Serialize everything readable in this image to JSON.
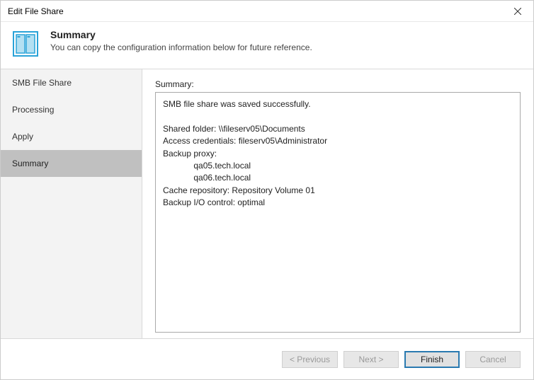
{
  "window": {
    "title": "Edit File Share"
  },
  "header": {
    "title": "Summary",
    "subtitle": "You can copy the configuration information below for future reference."
  },
  "sidebar": {
    "items": [
      {
        "label": "SMB File Share",
        "active": false
      },
      {
        "label": "Processing",
        "active": false
      },
      {
        "label": "Apply",
        "active": false
      },
      {
        "label": "Summary",
        "active": true
      }
    ]
  },
  "content": {
    "label": "Summary:",
    "summary_text": "SMB file share was saved successfully.\n\nShared folder: \\\\fileserv05\\Documents\nAccess credentials: fileserv05\\Administrator\nBackup proxy:\n             qa05.tech.local\n             qa06.tech.local\nCache repository: Repository Volume 01\nBackup I/O control: optimal"
  },
  "footer": {
    "previous": "< Previous",
    "next": "Next >",
    "finish": "Finish",
    "cancel": "Cancel"
  }
}
